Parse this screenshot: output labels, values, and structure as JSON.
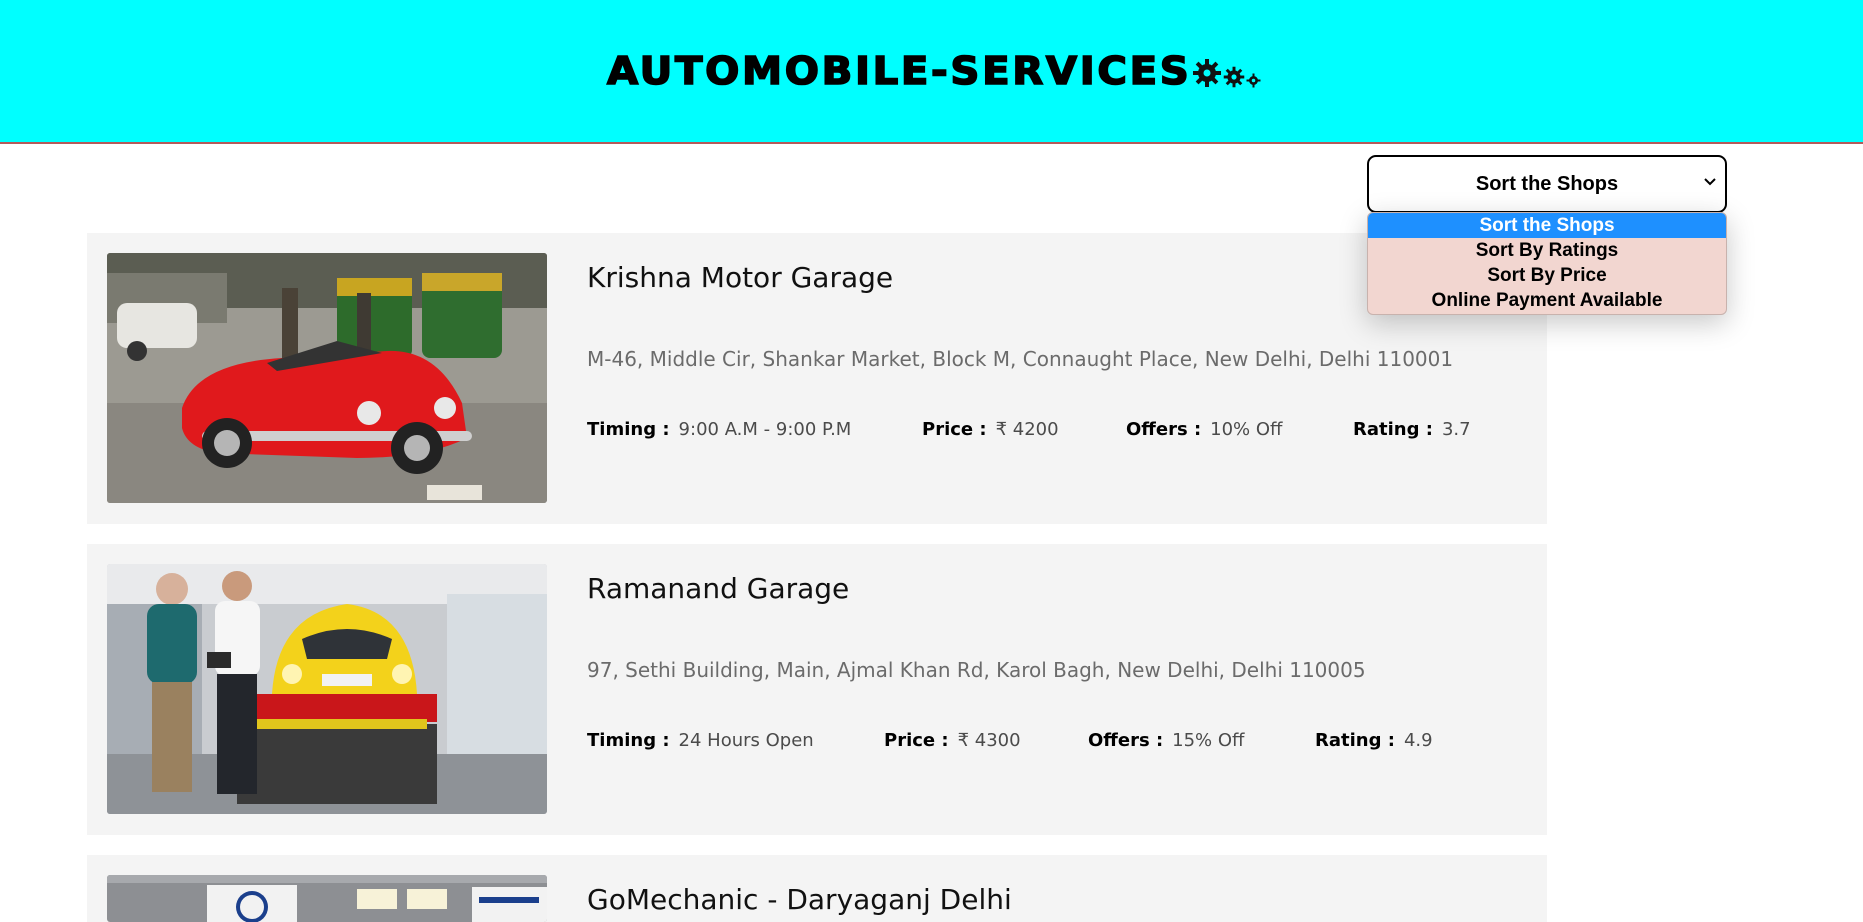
{
  "header": {
    "title": "AUTOMOBILE-SERVICES",
    "logo_icon": "gears-icon",
    "background": "#00ffff"
  },
  "sort": {
    "selected_label": "Sort the Shops",
    "options": [
      "Sort the Shops",
      "Sort By Ratings",
      "Sort By Price",
      "Online Payment Available"
    ],
    "highlight_color": "#1e90ff",
    "dropdown_background": "#f2d6d0"
  },
  "labels": {
    "timing": "Timing :",
    "price": "Price :",
    "offers": "Offers :",
    "rating": "Rating :"
  },
  "shops": [
    {
      "name": "Krishna Motor Garage",
      "address": "M-46, Middle Cir, Shankar Market, Block M, Connaught Place, New Delhi, Delhi 110001",
      "timing": "9:00 A.M - 9:00 P.M",
      "price": "₹ 4200",
      "offers": "10% Off",
      "rating": "3.7",
      "image": "red-convertible-car-photo"
    },
    {
      "name": "Ramanand Garage",
      "address": "97, Sethi Building, Main, Ajmal Khan Rd, Karol Bagh, New Delhi, Delhi 110005",
      "timing": "24 Hours Open",
      "price": "₹ 4300",
      "offers": "15% Off",
      "rating": "4.9",
      "image": "yellow-sports-car-workshop-photo"
    },
    {
      "name": "GoMechanic - Daryaganj Delhi",
      "image": "service-center-brand-signs-photo"
    }
  ]
}
